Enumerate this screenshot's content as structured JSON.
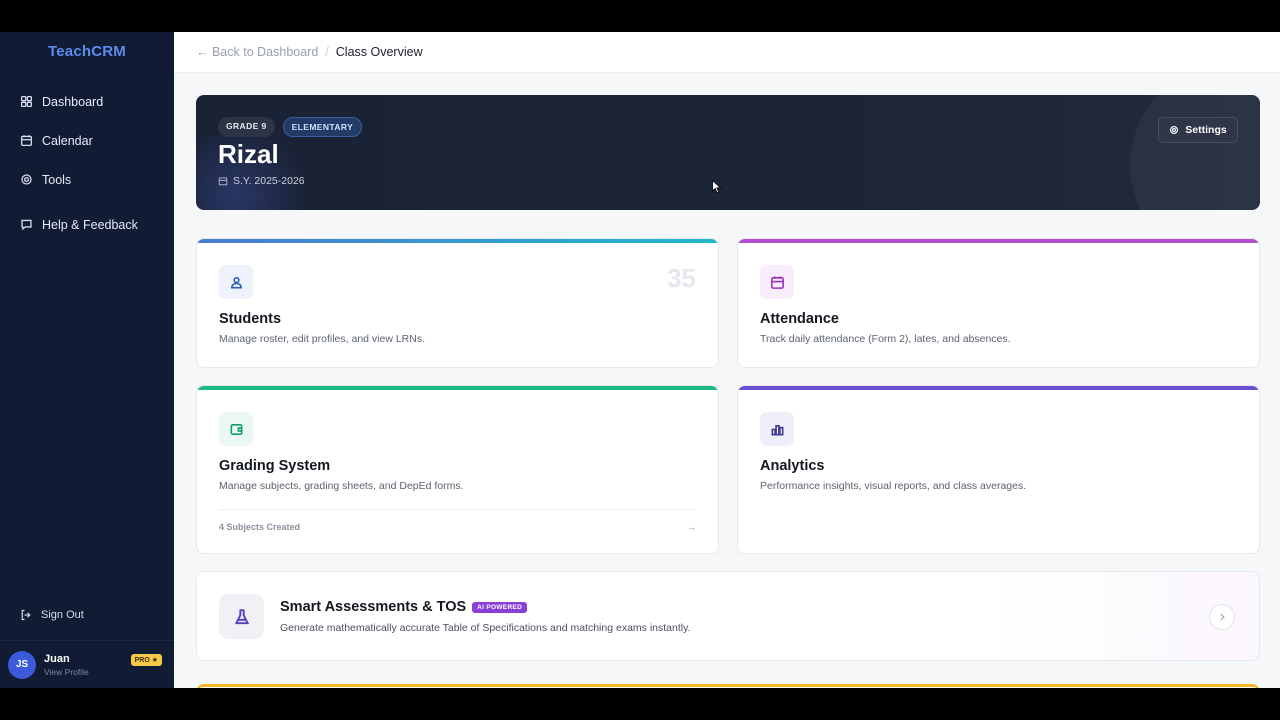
{
  "app": {
    "brand": "TeachCRM"
  },
  "sidebar": {
    "items": [
      {
        "label": "Dashboard",
        "icon": "grid-icon"
      },
      {
        "label": "Calendar",
        "icon": "calendar-icon"
      },
      {
        "label": "Tools",
        "icon": "gear-icon"
      },
      {
        "label": "Help & Feedback",
        "icon": "message-icon"
      }
    ],
    "sign_out": "Sign Out",
    "profile": {
      "initials": "JS",
      "name": "Juan",
      "sub": "View Profile",
      "badge": "PRO ★"
    }
  },
  "breadcrumb": {
    "back": "← Back to Dashboard",
    "separator": "/",
    "current": "Class Overview"
  },
  "hero": {
    "badges": [
      "GRADE 9",
      "ELEMENTARY"
    ],
    "title": "Rizal",
    "school_year": "S.Y. 2025-2026",
    "settings_label": "Settings"
  },
  "cards": {
    "students": {
      "title": "Students",
      "desc": "Manage roster, edit profiles, and view LRNs.",
      "count": "35",
      "accent": "#4a7bd6"
    },
    "attendance": {
      "title": "Attendance",
      "desc": "Track daily attendance (Form 2), lates, and absences.",
      "accent": "#b24fd1"
    },
    "grading": {
      "title": "Grading System",
      "desc": "Manage subjects, grading sheets, and DepEd forms.",
      "footer": "4 Subjects Created",
      "footer_arrow": "→",
      "accent": "#1fb982"
    },
    "analytics": {
      "title": "Analytics",
      "desc": "Performance insights, visual reports, and class averages.",
      "accent": "#6a4fd0"
    }
  },
  "assessments": {
    "title": "Smart Assessments & TOS",
    "badge": "AI POWERED",
    "desc": "Generate mathematically accurate Table of Specifications and matching exams instantly."
  }
}
